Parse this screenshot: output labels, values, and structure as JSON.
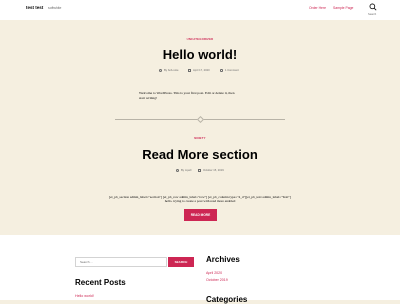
{
  "header": {
    "site_title": "test test",
    "site_description": "softwhite",
    "nav": [
      "Order Here",
      "Sample Page"
    ],
    "search_label": "Search"
  },
  "posts": [
    {
      "category": "UNCATEGORIZED",
      "title": "Hello world!",
      "author": "By bob-note",
      "date": "April 17, 2020",
      "comments": "1 Comment",
      "excerpt": [
        "Welcome to WordPress. This is your first post. Edit or delete it, then",
        "start writing!"
      ]
    },
    {
      "category": "NINETY",
      "title": "Read More section",
      "author": "By mpell",
      "date": "October 15, 2019",
      "shortcode_lines": [
        "[et_pb_section admin_label=\"section\"] [et_pb_row admin_label=\"row\"] [et_pb_column type=\"4_4\"][et_pb_text admin_label=\"Text\"]",
        "hello. trying to create a post with read more enabled"
      ],
      "read_more": "READ MORE"
    }
  ],
  "footer": {
    "search_placeholder": "Search ...",
    "search_button": "SEARCH",
    "recent_posts_title": "Recent Posts",
    "recent_posts": [
      "Hello world!"
    ],
    "archives_title": "Archives",
    "archives": [
      "April 2020",
      "October 2019"
    ],
    "categories_title": "Categories"
  },
  "colors": {
    "accent": "#cd2653",
    "background": "#f5efe0",
    "header_bg": "#ffffff"
  }
}
